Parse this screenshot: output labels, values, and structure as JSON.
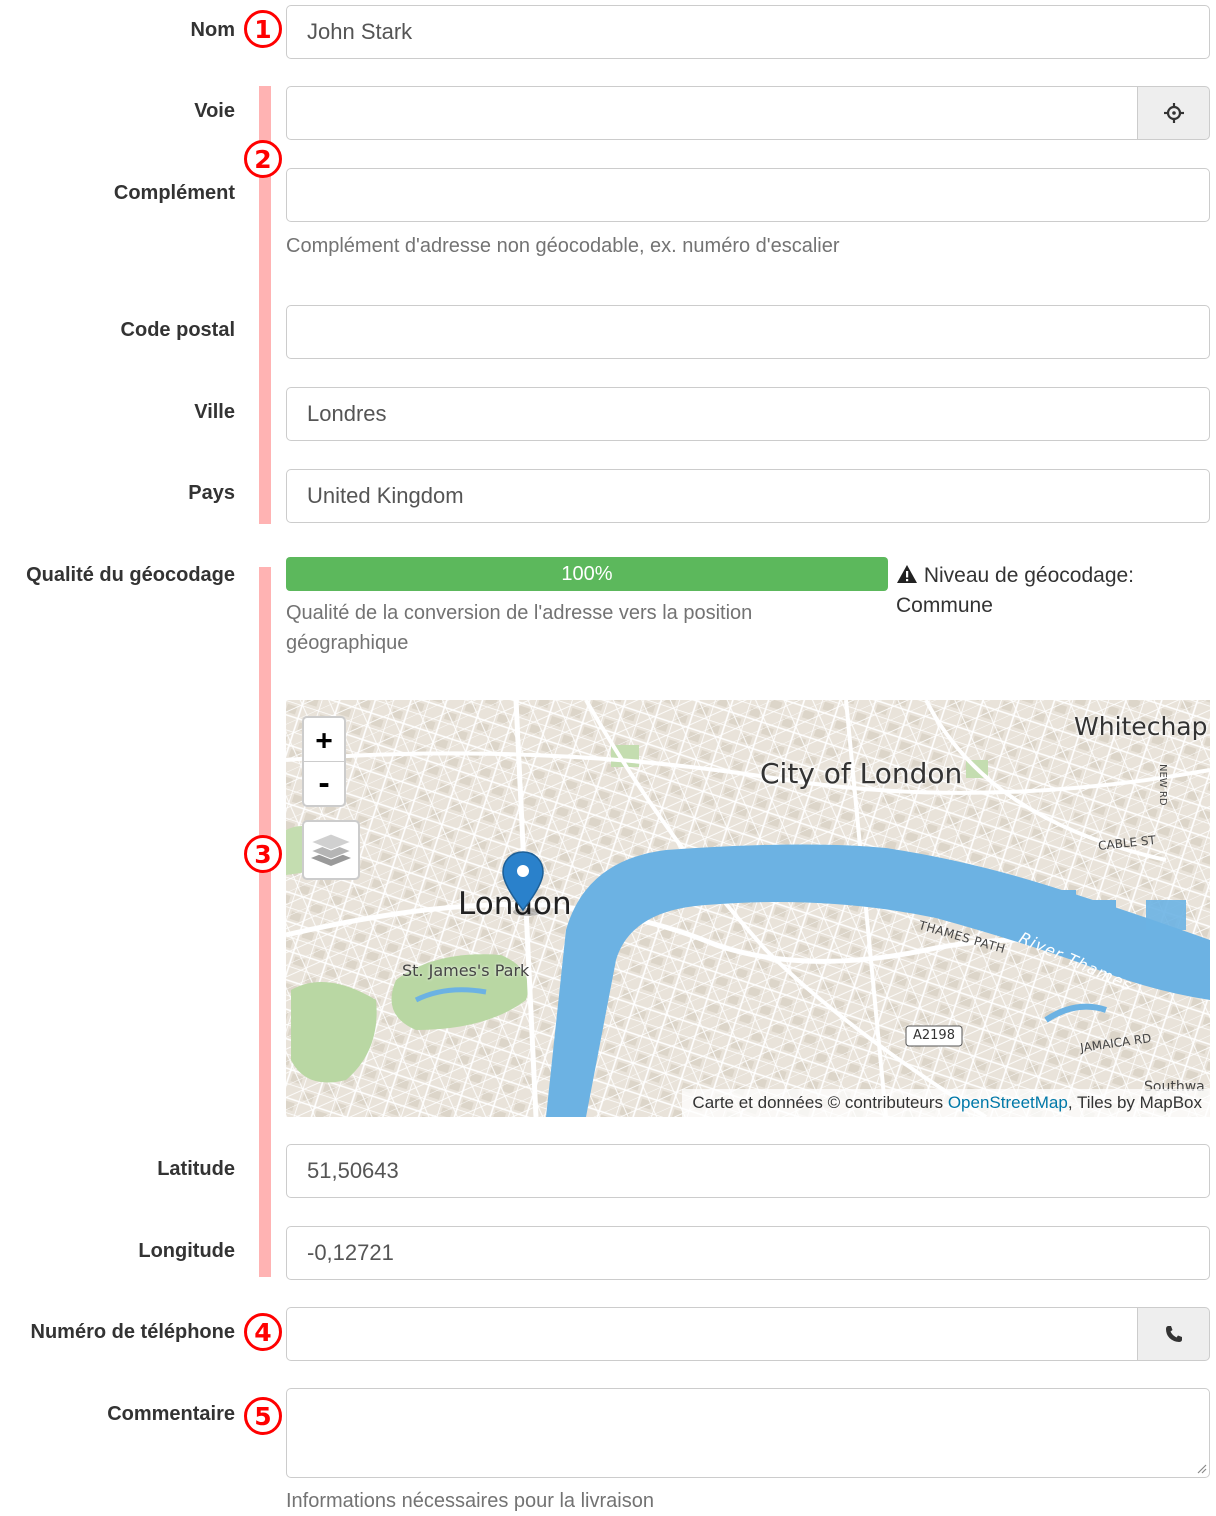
{
  "form": {
    "nom": {
      "label": "Nom",
      "value": "John Stark"
    },
    "voie": {
      "label": "Voie",
      "value": "",
      "addon_icon": "crosshairs-icon"
    },
    "complement": {
      "label": "Complément",
      "value": "",
      "help": "Complément d'adresse non géocodable, ex. numéro d'escalier"
    },
    "code_postal": {
      "label": "Code postal",
      "value": ""
    },
    "ville": {
      "label": "Ville",
      "value": "Londres"
    },
    "pays": {
      "label": "Pays",
      "value": "United Kingdom"
    },
    "geocoding": {
      "label": "Qualité du géocodage",
      "progress_text": "100%",
      "progress_value": 100,
      "help_line1": "Qualité de la conversion de l'adresse vers la position",
      "help_line2": "géographique",
      "level_label": "Niveau de géocodage:",
      "level_value": "Commune",
      "level_icon": "warning-icon"
    },
    "latitude": {
      "label": "Latitude",
      "value": "51,50643"
    },
    "longitude": {
      "label": "Longitude",
      "value": "-0,12721"
    },
    "telephone": {
      "label": "Numéro de téléphone",
      "value": "",
      "addon_icon": "phone-icon"
    },
    "commentaire": {
      "label": "Commentaire",
      "value": "",
      "help": "Informations nécessaires pour la livraison"
    }
  },
  "map": {
    "zoom_in": "+",
    "zoom_out": "-",
    "labels": {
      "city_of_london": "City of London",
      "london": "London",
      "whitechapel": "Whitechap",
      "st_james_park": "St. James's Park",
      "thames_path": "THAMES PATH",
      "river_thames": "River Thames",
      "cable_st": "CABLE ST",
      "jamaica_rd": "JAMAICA RD",
      "a2198": "A2198",
      "new_rd": "NEW RD",
      "southwark": "Southwa"
    },
    "attribution": {
      "prefix": "Carte et données © contributeurs ",
      "link": "OpenStreetMap",
      "suffix": ", Tiles by MapBox"
    }
  },
  "annotations": [
    "1",
    "2",
    "3",
    "4",
    "5"
  ],
  "colors": {
    "annotation_red": "#ff0000",
    "bar_pink": "#ffb3b3",
    "progress_green": "#5cb85c",
    "river_blue": "#6cb2e3",
    "park_green": "#b9d7a3",
    "marker_blue": "#2a81cb",
    "link_blue": "#0078a8"
  }
}
